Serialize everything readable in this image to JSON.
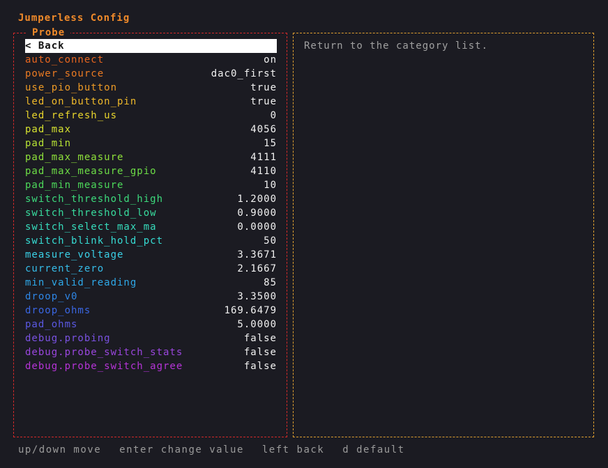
{
  "app": {
    "title": "Jumperless Config"
  },
  "panel": {
    "label": "Probe",
    "description": "Return to the category list."
  },
  "back_label": "< Back",
  "items": [
    {
      "name": "auto_connect",
      "value": "on",
      "color": "#e8651e"
    },
    {
      "name": "power_source",
      "value": "dac0_first",
      "color": "#ea7a22"
    },
    {
      "name": "use_pio_button",
      "value": "true",
      "color": "#ec9a26"
    },
    {
      "name": "led_on_button_pin",
      "value": "true",
      "color": "#eeb82a"
    },
    {
      "name": "led_refresh_us",
      "value": "0",
      "color": "#e8d52c"
    },
    {
      "name": "pad_max",
      "value": "4056",
      "color": "#d4e030"
    },
    {
      "name": "pad_min",
      "value": "15",
      "color": "#b6e234"
    },
    {
      "name": "pad_max_measure",
      "value": "4111",
      "color": "#8ee03a"
    },
    {
      "name": "pad_max_measure_gpio",
      "value": "4110",
      "color": "#6cdc46"
    },
    {
      "name": "pad_min_measure",
      "value": "10",
      "color": "#4cd85a"
    },
    {
      "name": "switch_threshold_high",
      "value": "1.2000",
      "color": "#3cda7c"
    },
    {
      "name": "switch_threshold_low",
      "value": "0.9000",
      "color": "#38dc9e"
    },
    {
      "name": "switch_select_max_ma",
      "value": "0.0000",
      "color": "#36dcbc"
    },
    {
      "name": "switch_blink_hold_pct",
      "value": "50",
      "color": "#36dcd4"
    },
    {
      "name": "measure_voltage",
      "value": "3.3671",
      "color": "#3ad0e6"
    },
    {
      "name": "current_zero",
      "value": "2.1667",
      "color": "#36bce8"
    },
    {
      "name": "min_valid_reading",
      "value": "85",
      "color": "#2ea8e8"
    },
    {
      "name": "droop_v0",
      "value": "3.3500",
      "color": "#2e86e6"
    },
    {
      "name": "droop_ohms",
      "value": "169.6479",
      "color": "#3a66e2"
    },
    {
      "name": "pad_ohms",
      "value": "5.0000",
      "color": "#5a58e2"
    },
    {
      "name": "debug.probing",
      "value": "false",
      "color": "#7a52e2"
    },
    {
      "name": "debug.probe_switch_stats",
      "value": "false",
      "color": "#9a46de"
    },
    {
      "name": "debug.probe_switch_agree",
      "value": "false",
      "color": "#b634d8"
    }
  ],
  "footer": {
    "move": "up/down move",
    "change": "enter change value",
    "back": "left back",
    "default": "d default"
  }
}
